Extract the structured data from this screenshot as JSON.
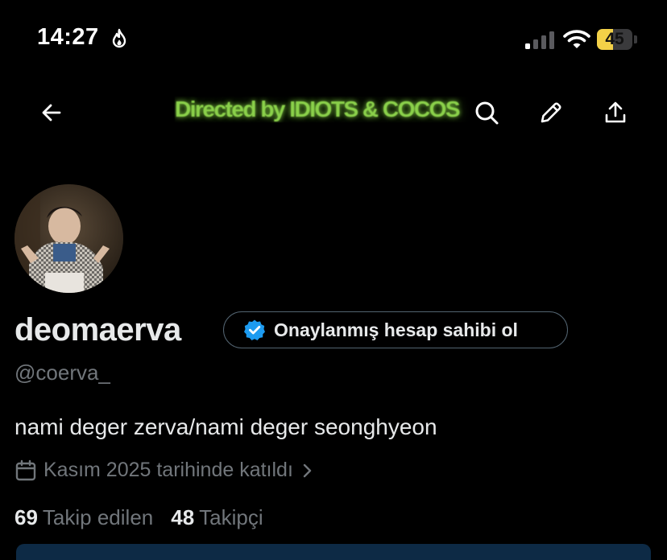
{
  "status_bar": {
    "time": "14:27",
    "battery_level": "45",
    "signal_bars_active": 1,
    "icons": [
      "flame-icon",
      "signal-icon",
      "wifi-icon",
      "battery-icon"
    ]
  },
  "banner": {
    "text": "Directed by IDIOTS & COCOS"
  },
  "nav": {
    "icons": [
      "back-arrow-icon",
      "search-icon",
      "edit-icon",
      "share-icon"
    ]
  },
  "profile": {
    "display_name": "deomaerva",
    "verify_label": "Onaylanmış hesap sahibi ol",
    "handle": "@coerva_",
    "bio": "nami deger zerva/nami deger seonghyeon",
    "joined": "Kasım 2025 tarihinde katıldı",
    "following_count": "69",
    "following_label": "Takip edilen",
    "followers_count": "48",
    "followers_label": "Takipçi"
  },
  "colors": {
    "background": "#000000",
    "muted_text": "#71767b",
    "verified_blue": "#1d9bf0",
    "battery_yellow": "#f3d148",
    "banner_green": "#8ad04a"
  }
}
